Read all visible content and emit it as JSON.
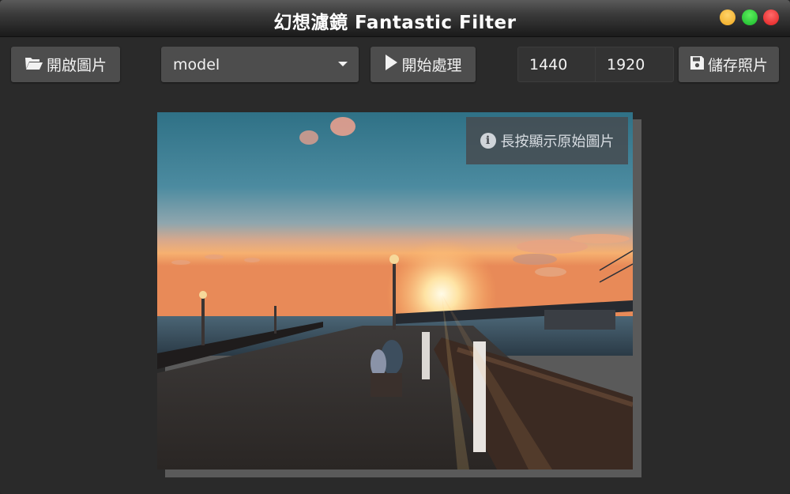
{
  "window": {
    "title": "幻想濾鏡 Fantastic Filter"
  },
  "toolbar": {
    "open_label": "開啟圖片",
    "open_icon": "folder-open-icon",
    "model_selected": "model",
    "run_label": "開始處理",
    "run_icon": "play-icon",
    "width_value": "1440",
    "height_value": "1920",
    "save_label": "儲存照片",
    "save_icon": "floppy-disk-icon"
  },
  "preview": {
    "hint_text": "長按顯示原始圖片",
    "hint_icon": "info-icon",
    "image_description_icon": "photo-preview"
  },
  "colors": {
    "background": "#2a2a2a",
    "button": "#4d4d4d",
    "field": "#333333",
    "text": "#f2f2f2"
  }
}
